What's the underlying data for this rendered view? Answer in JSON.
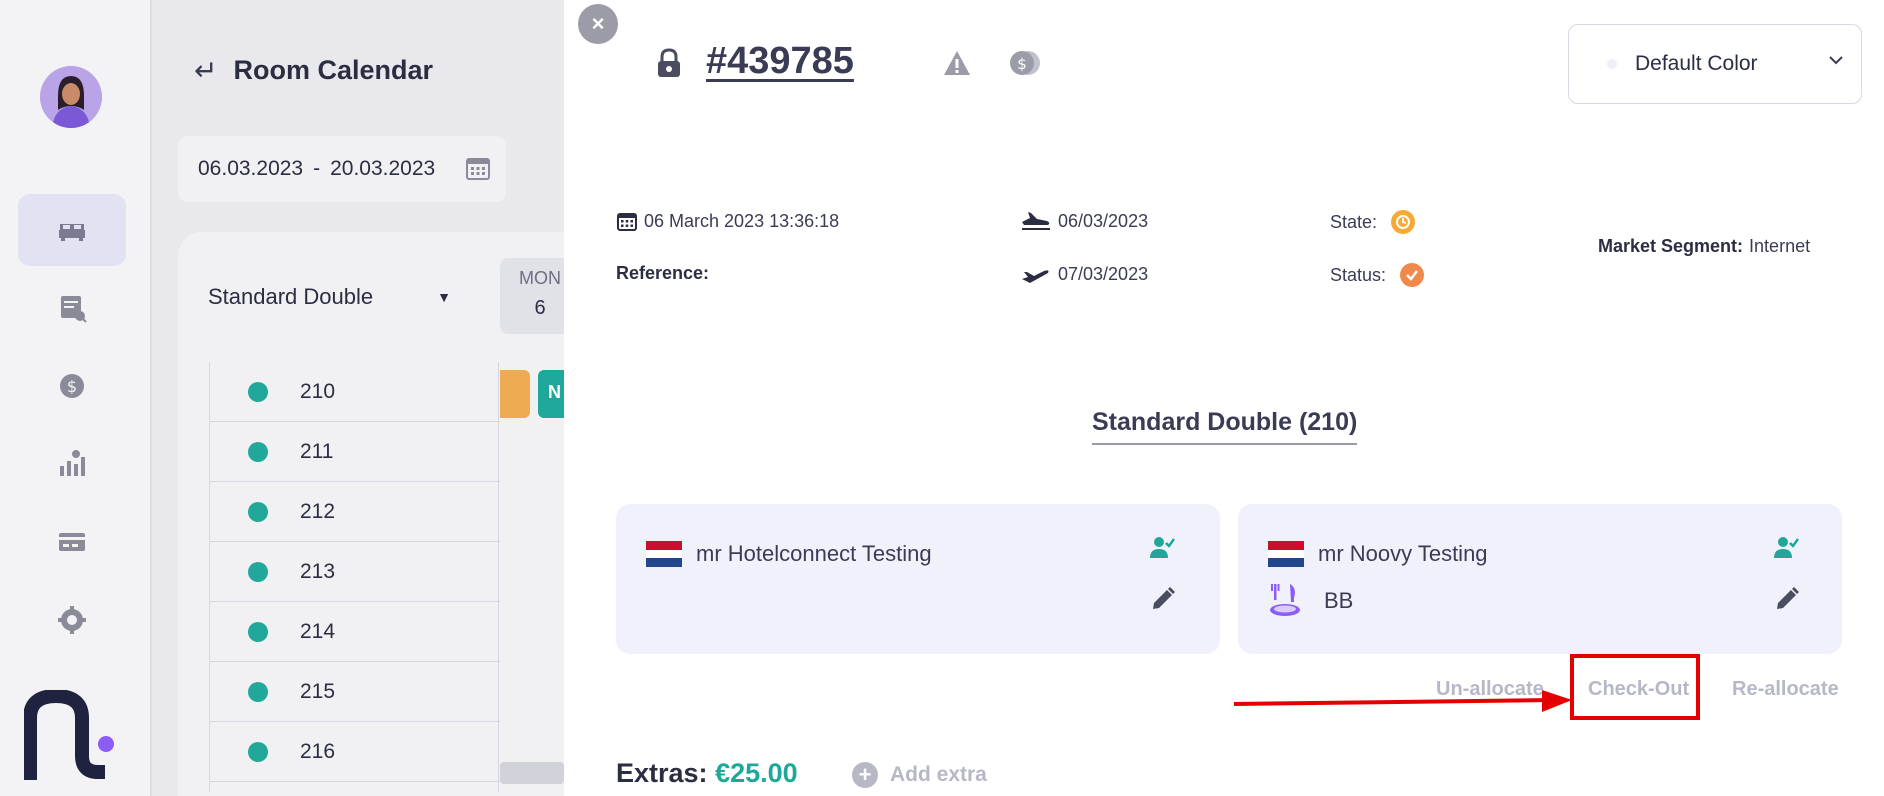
{
  "calendar": {
    "title": "Room Calendar",
    "date_from": "06.03.2023",
    "date_sep": "-",
    "date_to": "20.03.2023",
    "room_type": "Standard Double",
    "day_name": "MON",
    "day_num": "6",
    "booking_b_initial": "N",
    "rooms": [
      "210",
      "211",
      "212",
      "213",
      "214",
      "215",
      "216"
    ]
  },
  "reservation": {
    "number": "#439785",
    "created": "06 March 2023 13:36:18",
    "reference_label": "Reference:",
    "arrival": "06/03/2023",
    "departure": "07/03/2023",
    "state_label": "State:",
    "status_label": "Status:",
    "market_segment_label": "Market Segment:",
    "market_segment_value": "Internet",
    "color_select": "Default Color",
    "room_heading": "Standard Double (210)"
  },
  "guests": [
    {
      "name": "mr Hotelconnect Testing"
    },
    {
      "name": "mr Noovy Testing",
      "meal": "BB"
    }
  ],
  "actions": {
    "unallocate": "Un-allocate",
    "checkout": "Check-Out",
    "reallocate": "Re-allocate"
  },
  "extras": {
    "label": "Extras:",
    "amount": "€25.00",
    "add_label": "Add extra"
  },
  "colors": {
    "accent_teal": "#1fa89a",
    "state_orange": "#f7a935",
    "highlight_red": "#e40000"
  }
}
